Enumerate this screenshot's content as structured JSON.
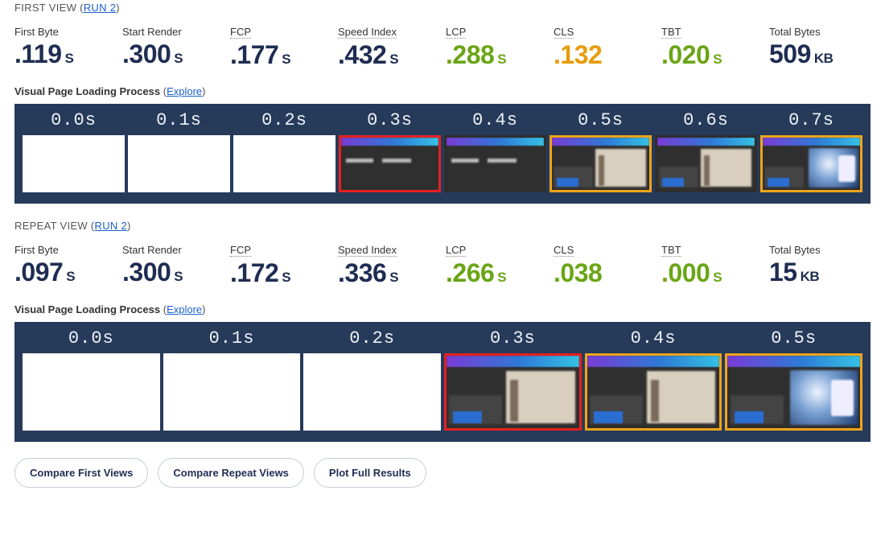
{
  "chart_data": {
    "type": "table",
    "title": "WebPageTest performance metrics — First View vs Repeat View",
    "series": [
      {
        "name": "First View (Run 2)",
        "values": {
          "First Byte (s)": 0.119,
          "Start Render (s)": 0.3,
          "FCP (s)": 0.177,
          "Speed Index (s)": 0.432,
          "LCP (s)": 0.288,
          "CLS": 0.132,
          "TBT (s)": 0.02,
          "Total Bytes (KB)": 509
        }
      },
      {
        "name": "Repeat View (Run 2)",
        "values": {
          "First Byte (s)": 0.097,
          "Start Render (s)": 0.3,
          "FCP (s)": 0.172,
          "Speed Index (s)": 0.336,
          "LCP (s)": 0.266,
          "CLS": 0.038,
          "TBT (s)": 0.0,
          "Total Bytes (KB)": 15
        }
      }
    ],
    "filmstrip": {
      "first_view_times_s": [
        0.0,
        0.1,
        0.2,
        0.3,
        0.4,
        0.5,
        0.6,
        0.7
      ],
      "repeat_view_times_s": [
        0.0,
        0.1,
        0.2,
        0.3,
        0.4,
        0.5
      ]
    }
  },
  "first": {
    "title": "FIRST VIEW",
    "run_paren_open": "(",
    "run_link": "RUN 2",
    "run_paren_close": ")",
    "metrics": [
      {
        "label": "First Byte",
        "value": ".119",
        "unit": "S",
        "color": "navy",
        "ul": false
      },
      {
        "label": "Start Render",
        "value": ".300",
        "unit": "S",
        "color": "navy",
        "ul": false
      },
      {
        "label": "FCP",
        "value": ".177",
        "unit": "S",
        "color": "navy",
        "ul": true
      },
      {
        "label": "Speed Index",
        "value": ".432",
        "unit": "S",
        "color": "navy",
        "ul": true
      },
      {
        "label": "LCP",
        "value": ".288",
        "unit": "S",
        "color": "green",
        "ul": true
      },
      {
        "label": "CLS",
        "value": ".132",
        "unit": "",
        "color": "orange",
        "ul": true
      },
      {
        "label": "TBT",
        "value": ".020",
        "unit": "S",
        "color": "green",
        "ul": true
      },
      {
        "label": "Total Bytes",
        "value": "509",
        "unit": "KB",
        "color": "navy",
        "ul": false
      }
    ],
    "visual_label": "Visual Page Loading Process",
    "explore": "Explore",
    "frames": [
      {
        "time": "0.0s",
        "state": "blank",
        "ring": "none"
      },
      {
        "time": "0.1s",
        "state": "blank",
        "ring": "none"
      },
      {
        "time": "0.2s",
        "state": "blank",
        "ring": "none"
      },
      {
        "time": "0.3s",
        "state": "headers",
        "ring": "red"
      },
      {
        "time": "0.4s",
        "state": "headers",
        "ring": "none"
      },
      {
        "time": "0.5s",
        "state": "partial",
        "ring": "orange"
      },
      {
        "time": "0.6s",
        "state": "partial",
        "ring": "none"
      },
      {
        "time": "0.7s",
        "state": "full",
        "ring": "orange"
      }
    ]
  },
  "repeat": {
    "title": "REPEAT VIEW",
    "run_paren_open": "(",
    "run_link": "RUN 2",
    "run_paren_close": ")",
    "metrics": [
      {
        "label": "First Byte",
        "value": ".097",
        "unit": "S",
        "color": "navy",
        "ul": false
      },
      {
        "label": "Start Render",
        "value": ".300",
        "unit": "S",
        "color": "navy",
        "ul": false
      },
      {
        "label": "FCP",
        "value": ".172",
        "unit": "S",
        "color": "navy",
        "ul": true
      },
      {
        "label": "Speed Index",
        "value": ".336",
        "unit": "S",
        "color": "navy",
        "ul": true
      },
      {
        "label": "LCP",
        "value": ".266",
        "unit": "S",
        "color": "green",
        "ul": true
      },
      {
        "label": "CLS",
        "value": ".038",
        "unit": "",
        "color": "green",
        "ul": true
      },
      {
        "label": "TBT",
        "value": ".000",
        "unit": "S",
        "color": "green",
        "ul": true
      },
      {
        "label": "Total Bytes",
        "value": "15",
        "unit": "KB",
        "color": "navy",
        "ul": false
      }
    ],
    "visual_label": "Visual Page Loading Process",
    "explore": "Explore",
    "frames": [
      {
        "time": "0.0s",
        "state": "blank",
        "ring": "none"
      },
      {
        "time": "0.1s",
        "state": "blank",
        "ring": "none"
      },
      {
        "time": "0.2s",
        "state": "blank",
        "ring": "none"
      },
      {
        "time": "0.3s",
        "state": "partial",
        "ring": "red"
      },
      {
        "time": "0.4s",
        "state": "partial",
        "ring": "orange"
      },
      {
        "time": "0.5s",
        "state": "full",
        "ring": "orange"
      }
    ]
  },
  "buttons": {
    "compare_first": "Compare First Views",
    "compare_repeat": "Compare Repeat Views",
    "plot_full": "Plot Full Results"
  }
}
